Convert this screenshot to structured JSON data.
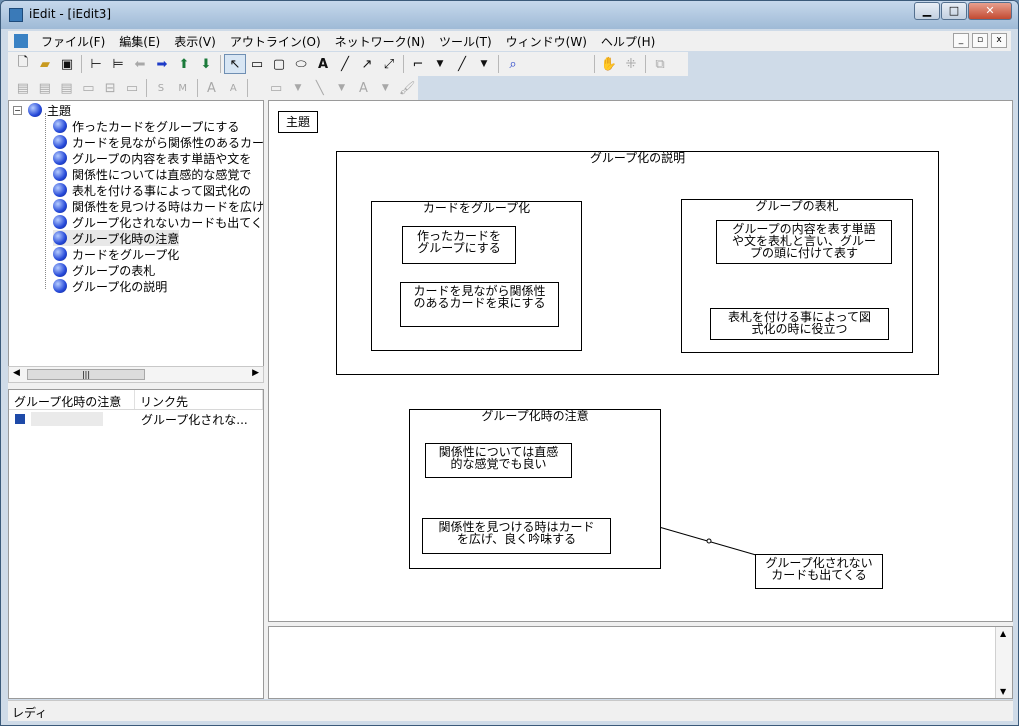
{
  "window": {
    "title": "iEdit - [iEdit3]"
  },
  "menu": [
    "ファイル(F)",
    "編集(E)",
    "表示(V)",
    "アウトライン(O)",
    "ネットワーク(N)",
    "ツール(T)",
    "ウィンドウ(W)",
    "ヘルプ(H)"
  ],
  "tree": {
    "root": "主題",
    "items": [
      "作ったカードをグループにする",
      "カードを見ながら関係性のあるカー",
      "グループの内容を表す単語や文を",
      "関係性については直感的な感覚で",
      "表札を付ける事によって図式化の",
      "関係性を見つける時はカードを広け",
      "グループ化されないカードも出てく",
      "グループ化時の注意",
      "カードをグループ化",
      "グループの表札",
      "グループ化の説明"
    ]
  },
  "links": {
    "columns": [
      "グループ化時の注意",
      "リンク先"
    ],
    "rows": [
      {
        "target": "グループ化されな..."
      }
    ]
  },
  "canvas": {
    "root_label": "主題",
    "group_outer": "グループ化の説明",
    "group_card": "カードをグループ化",
    "group_label": "グループの表札",
    "group_caution": "グループ化時の注意",
    "card1": [
      "作ったカードを",
      "グループにする"
    ],
    "card2": [
      "カードを見ながら関係性",
      "のあるカードを束にする"
    ],
    "card3": [
      "グループの内容を表す単語",
      "や文を表札と言い、グルー",
      "プの頭に付けて表す"
    ],
    "card4": [
      "表札を付ける事によって図",
      "式化の時に役立つ"
    ],
    "card5": [
      "関係性については直感",
      "的な感覚でも良い"
    ],
    "card6": [
      "関係性を見つける時はカード",
      "を広げ、良く吟味する"
    ],
    "card7": [
      "グループ化されない",
      "カードも出てくる"
    ]
  },
  "status": "レディ",
  "colors": {
    "titlebar": "#b5cbe3",
    "node_ball": "#2448d8"
  }
}
